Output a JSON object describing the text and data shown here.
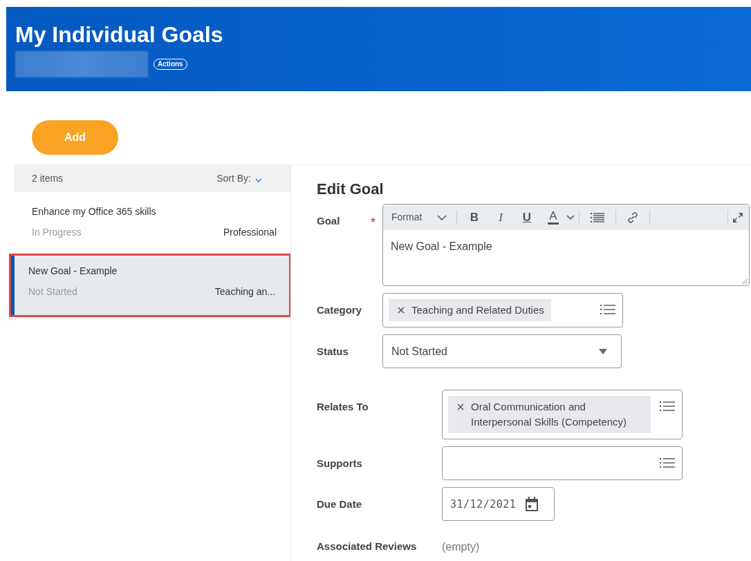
{
  "header": {
    "title": "My Individual Goals",
    "actions_label": "Actions"
  },
  "add_button": "Add",
  "list": {
    "count": "2 items",
    "sort_label": "Sort By:",
    "items": [
      {
        "title": "Enhance my Office 365 skills",
        "status": "In Progress",
        "category": "Professional",
        "selected": false
      },
      {
        "title": "New Goal - Example",
        "status": "Not Started",
        "category": "Teaching an...",
        "selected": true
      }
    ]
  },
  "form": {
    "heading": "Edit Goal",
    "goal": {
      "label": "Goal",
      "required_mark": "*",
      "format_label": "Format",
      "toolbar_buttons": [
        {
          "kind": "bold",
          "text": "B"
        },
        {
          "kind": "italic",
          "text": "I"
        },
        {
          "kind": "underline",
          "text": "U"
        },
        {
          "kind": "color",
          "text": "A"
        }
      ],
      "value": "New Goal - Example"
    },
    "category": {
      "label": "Category",
      "tags": [
        "Teaching and Related Duties"
      ]
    },
    "status": {
      "label": "Status",
      "value": "Not Started"
    },
    "relates_to": {
      "label": "Relates To",
      "tags": [
        "Oral Communication and Interpersonal Skills (Competency)"
      ]
    },
    "supports": {
      "label": "Supports"
    },
    "due_date": {
      "label": "Due Date",
      "value": "31/12/2021"
    },
    "associated_reviews": {
      "label": "Associated Reviews",
      "value": "(empty)"
    }
  }
}
